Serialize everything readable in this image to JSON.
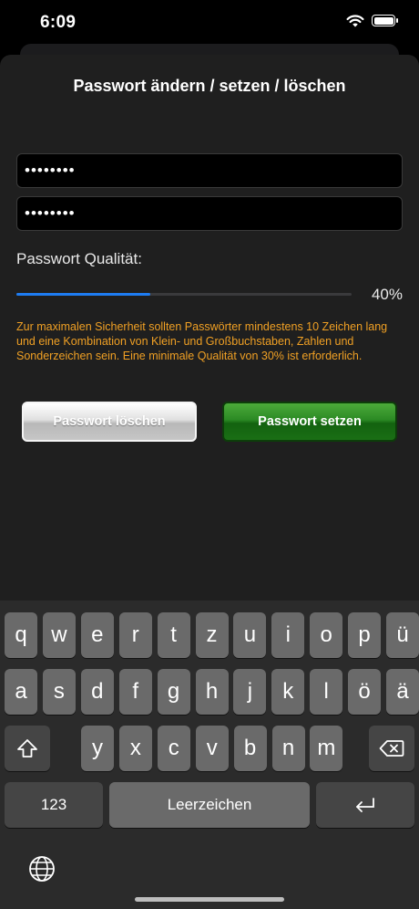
{
  "status_bar": {
    "time": "6:09"
  },
  "dialog": {
    "title": "Passwort ändern / setzen / löschen",
    "password_field_1": "••••••••",
    "password_field_2": "••••••••",
    "quality_label": "Passwort Qualität:",
    "quality_percent_text": "40%",
    "quality_fraction": 0.4,
    "info_text": "Zur maximalen Sicherheit sollten Passwörter mindestens 10 Zeichen lang und eine Kombination von Klein- und Großbuchstaben, Zahlen und Sonderzeichen sein. Eine minimale Qualität von 30% ist erforderlich.",
    "delete_button": "Passwort löschen",
    "set_button": "Passwort setzen"
  },
  "keyboard": {
    "row1": [
      "q",
      "w",
      "e",
      "r",
      "t",
      "z",
      "u",
      "i",
      "o",
      "p",
      "ü"
    ],
    "row2": [
      "a",
      "s",
      "d",
      "f",
      "g",
      "h",
      "j",
      "k",
      "l",
      "ö",
      "ä"
    ],
    "row3": [
      "y",
      "x",
      "c",
      "v",
      "b",
      "n",
      "m"
    ],
    "numbers_key": "123",
    "space_key": "Leerzeichen",
    "icons": {
      "shift": "shift-icon",
      "backspace": "backspace-icon",
      "return": "return-icon",
      "globe": "globe-icon"
    }
  },
  "colors": {
    "accent_blue": "#1e7cf2",
    "info_orange": "#f0a024",
    "set_button_green": "#2b8a24"
  }
}
